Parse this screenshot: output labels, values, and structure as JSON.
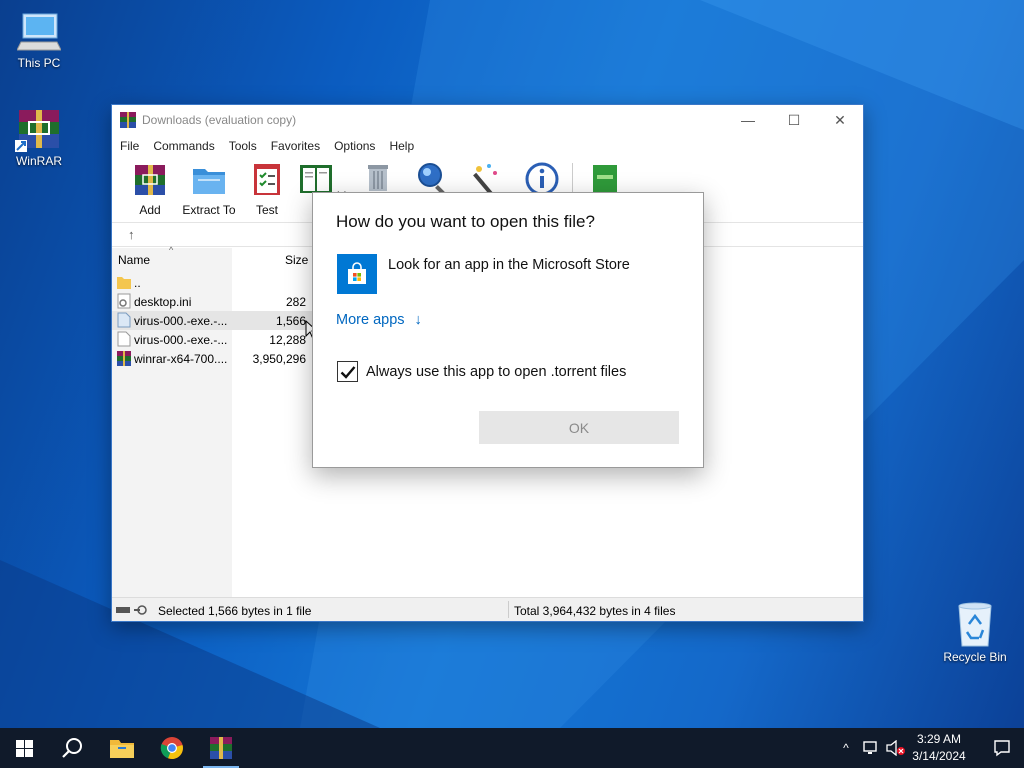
{
  "desktop": {
    "icons": [
      {
        "label": "This PC",
        "icon": "computer-icon"
      },
      {
        "label": "WinRAR",
        "icon": "winrar-icon"
      },
      {
        "label": "Recycle Bin",
        "icon": "recycle-bin-icon"
      }
    ]
  },
  "window": {
    "title": "Downloads (evaluation copy)",
    "menu": [
      "File",
      "Commands",
      "Tools",
      "Favorites",
      "Options",
      "Help"
    ],
    "toolbar": [
      {
        "label": "Add",
        "icon": "add-archive-icon"
      },
      {
        "label": "Extract To",
        "icon": "extract-folder-icon"
      },
      {
        "label": "Test",
        "icon": "test-clipboard-icon"
      },
      {
        "label": "V",
        "icon": "view-book-icon"
      }
    ],
    "columns": {
      "name": "Name",
      "size": "Size"
    },
    "files": [
      {
        "name": "..",
        "size": "",
        "icon": "folder-icon"
      },
      {
        "name": "desktop.ini",
        "size": "282",
        "icon": "settings-file-icon"
      },
      {
        "name": "virus-000.-exe.-...",
        "size": "1,566",
        "icon": "file-icon",
        "selected": true
      },
      {
        "name": "virus-000.-exe.-...",
        "size": "12,288",
        "icon": "file-icon"
      },
      {
        "name": "winrar-x64-700....",
        "size": "3,950,296",
        "icon": "winrar-icon"
      }
    ],
    "status_left": "Selected 1,566 bytes in 1 file",
    "status_right": "Total 3,964,432 bytes in 4 files"
  },
  "dialog": {
    "title": "How do you want to open this file?",
    "store_option": "Look for an app in the Microsoft Store",
    "more_apps": "More apps",
    "checkbox_label": "Always use this app to open .torrent files",
    "checkbox_checked": true,
    "ok": "OK"
  },
  "taskbar": {
    "time": "3:29 AM",
    "date": "3/14/2024"
  }
}
